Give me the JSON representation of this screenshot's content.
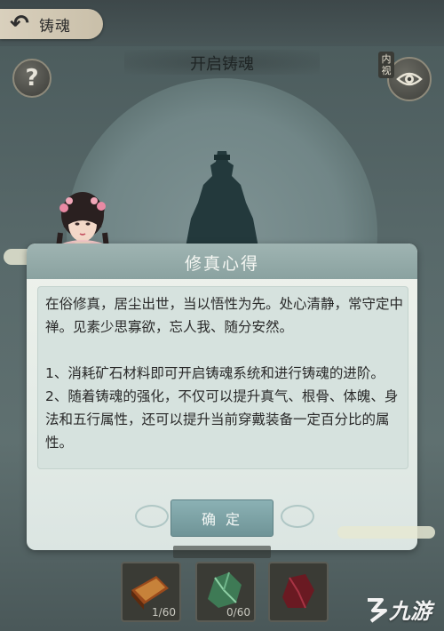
{
  "topbar": {
    "back_title": "铸魂"
  },
  "header": {
    "open_title": "开启铸魂",
    "help_symbol": "?",
    "eye_label": "内视"
  },
  "dialog": {
    "title": "修真心得",
    "paragraphs": [
      "在俗修真，居尘出世，当以悟性为先。处心清静，常守定中禅。见素少思寡欲，忘人我、随分安然。",
      "1、消耗矿石材料即可开启铸魂系统和进行铸魂的进阶。",
      "2、随着铸魂的强化，不仅可以提升真气、根骨、体魄、身法和五行属性，还可以提升当前穿戴装备一定百分比的属性。"
    ],
    "confirm_label": "确 定"
  },
  "materials": [
    {
      "name": "wood-ore",
      "count": "1/60",
      "color": "#9a4a1c"
    },
    {
      "name": "green-ore",
      "count": "0/60",
      "color": "#3e7a55"
    },
    {
      "name": "red-ore",
      "count": "",
      "color": "#6a1a22"
    }
  ],
  "watermark": {
    "text": "九游"
  },
  "colors": {
    "accent": "#7fa5a8",
    "dialog_header": "#9fb4b2"
  }
}
